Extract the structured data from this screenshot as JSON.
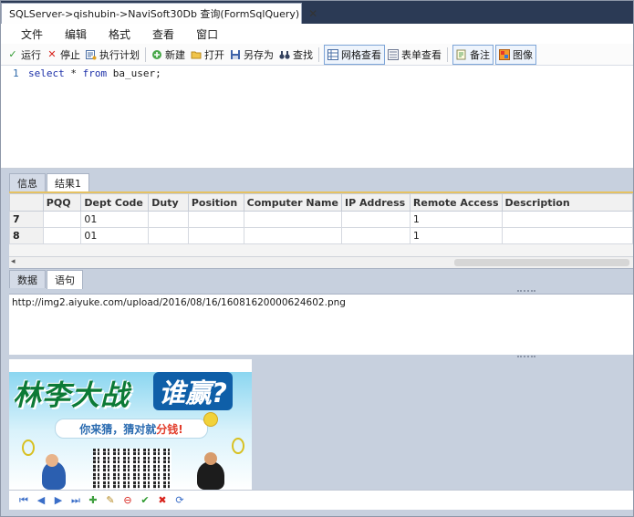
{
  "window": {
    "tab_title": "SQLServer->qishubin->NaviSoft30Db 查询(FormSqlQuery)",
    "close_glyph": "✕"
  },
  "menu": [
    "文件",
    "编辑",
    "格式",
    "查看",
    "窗口"
  ],
  "toolbar": {
    "run": "运行",
    "stop": "停止",
    "explain": "执行计划",
    "new": "新建",
    "open": "打开",
    "save_as": "另存为",
    "find": "查找",
    "grid_view": "网格查看",
    "form_view": "表单查看",
    "memo": "备注",
    "image": "图像"
  },
  "editor": {
    "line_number": "1",
    "code_keyword1": "select",
    "code_mid": " * ",
    "code_keyword2": "from",
    "code_rest": " ba_user;"
  },
  "result_tabs": [
    "信息",
    "结果1"
  ],
  "grid": {
    "columns": [
      "PQQ",
      "Dept Code",
      "Duty",
      "Position",
      "Computer Name",
      "IP Address",
      "Remote Access",
      "Description"
    ],
    "rows": [
      {
        "num": "7",
        "cells": [
          "",
          "01",
          "",
          "",
          "",
          "",
          "1",
          ""
        ]
      },
      {
        "num": "8",
        "cells": [
          "",
          "01",
          "",
          "",
          "",
          "",
          "1",
          ""
        ]
      }
    ],
    "scroll_left_glyph": "◂"
  },
  "detail_tabs": [
    "数据",
    "语句"
  ],
  "text_panel": {
    "value": "http://img2.aiyuke.com/upload/2016/08/16/16081620000624602.png"
  },
  "banner": {
    "title": "林李大战",
    "question": "谁赢?",
    "subtitle_a": "你来猜，猜对就",
    "subtitle_b": "分钱!"
  },
  "navbar": {
    "first": "⏮",
    "prev": "◀",
    "next": "▶",
    "last": "⏭",
    "insert": "✚",
    "edit": "✎",
    "delete": "⊖",
    "post": "✔",
    "cancel": "✖",
    "refresh": "⟳"
  },
  "colors": {
    "accent": "#2b3a55",
    "selection_border": "#7fa6d8",
    "grid_top_border": "#e6c262"
  }
}
